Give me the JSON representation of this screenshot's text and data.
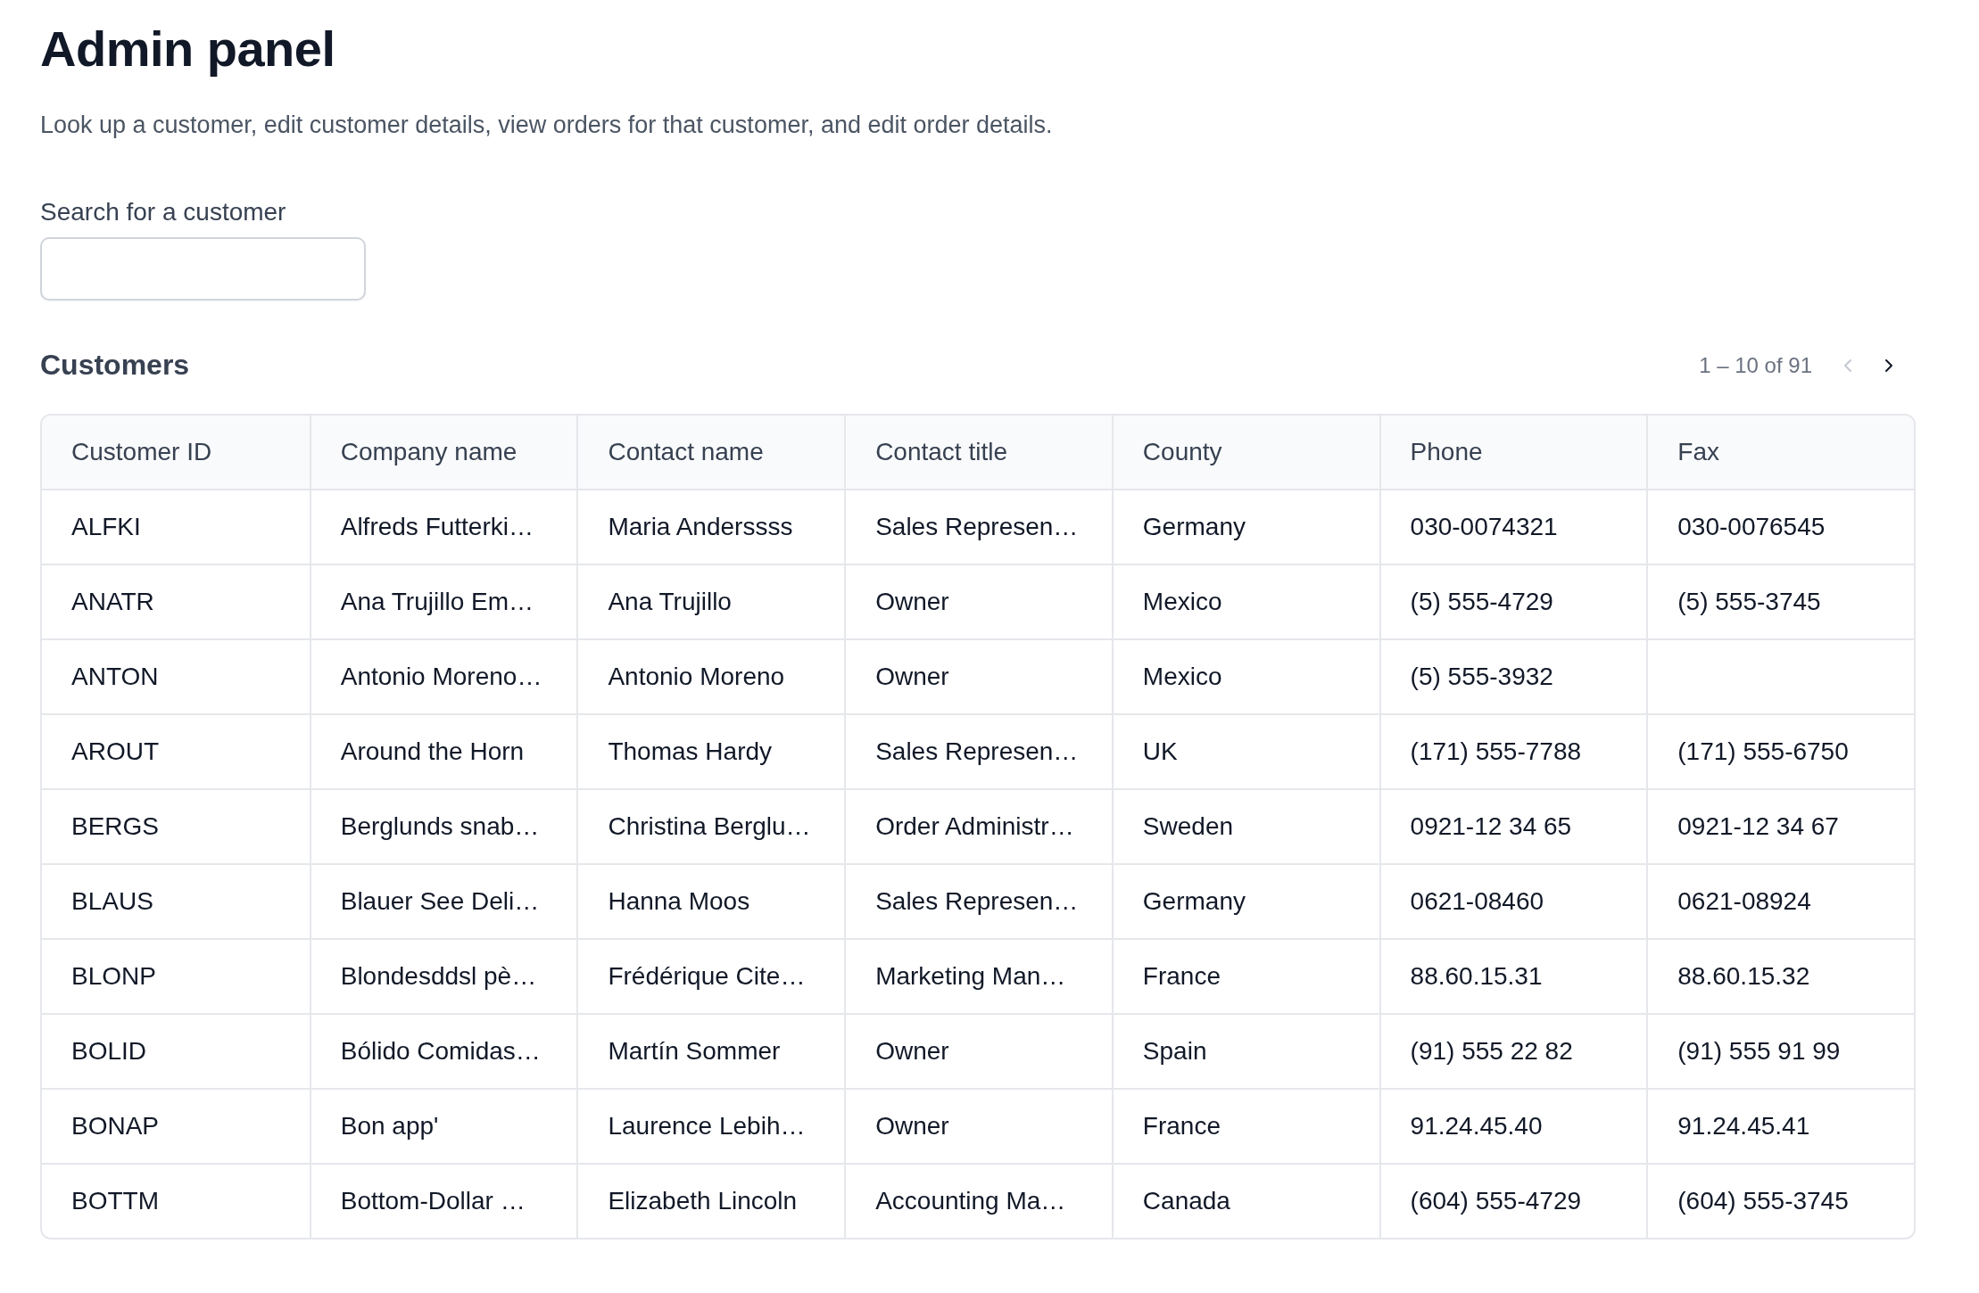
{
  "page": {
    "title": "Admin panel",
    "description": "Look up a customer, edit customer details, view orders for that customer, and edit order details."
  },
  "search": {
    "label": "Search for a customer"
  },
  "customers": {
    "title": "Customers",
    "pagination": {
      "range": "1 – 10 of 91",
      "prev_disabled": true,
      "next_disabled": false
    },
    "columns": [
      "Customer ID",
      "Company name",
      "Contact name",
      "Contact title",
      "County",
      "Phone",
      "Fax"
    ],
    "rows": [
      [
        "ALFKI",
        "Alfreds Futterki…",
        "Maria Anderssss",
        "Sales Represen…",
        "Germany",
        "030-0074321",
        "030-0076545"
      ],
      [
        "ANATR",
        "Ana Trujillo Em…",
        "Ana Trujillo",
        "Owner",
        "Mexico",
        "(5) 555-4729",
        "(5) 555-3745"
      ],
      [
        "ANTON",
        "Antonio Moreno…",
        "Antonio Moreno",
        "Owner",
        "Mexico",
        "(5) 555-3932",
        ""
      ],
      [
        "AROUT",
        "Around the Horn",
        "Thomas Hardy",
        "Sales Represen…",
        "UK",
        "(171) 555-7788",
        "(171) 555-6750"
      ],
      [
        "BERGS",
        "Berglunds snab…",
        "Christina Berglu…",
        "Order Administr…",
        "Sweden",
        "0921-12 34 65",
        "0921-12 34 67"
      ],
      [
        "BLAUS",
        "Blauer See Deli…",
        "Hanna Moos",
        "Sales Represen…",
        "Germany",
        "0621-08460",
        "0621-08924"
      ],
      [
        "BLONP",
        "Blondesddsl pè…",
        "Frédérique Cite…",
        "Marketing Man…",
        "France",
        "88.60.15.31",
        "88.60.15.32"
      ],
      [
        "BOLID",
        "Bólido Comidas…",
        "Martín Sommer",
        "Owner",
        "Spain",
        "(91) 555 22 82",
        "(91) 555 91 99"
      ],
      [
        "BONAP",
        "Bon app'",
        "Laurence Lebih…",
        "Owner",
        "France",
        "91.24.45.40",
        "91.24.45.41"
      ],
      [
        "BOTTM",
        "Bottom-Dollar …",
        "Elizabeth Lincoln",
        "Accounting Ma…",
        "Canada",
        "(604) 555-4729",
        "(604) 555-3745"
      ]
    ]
  }
}
